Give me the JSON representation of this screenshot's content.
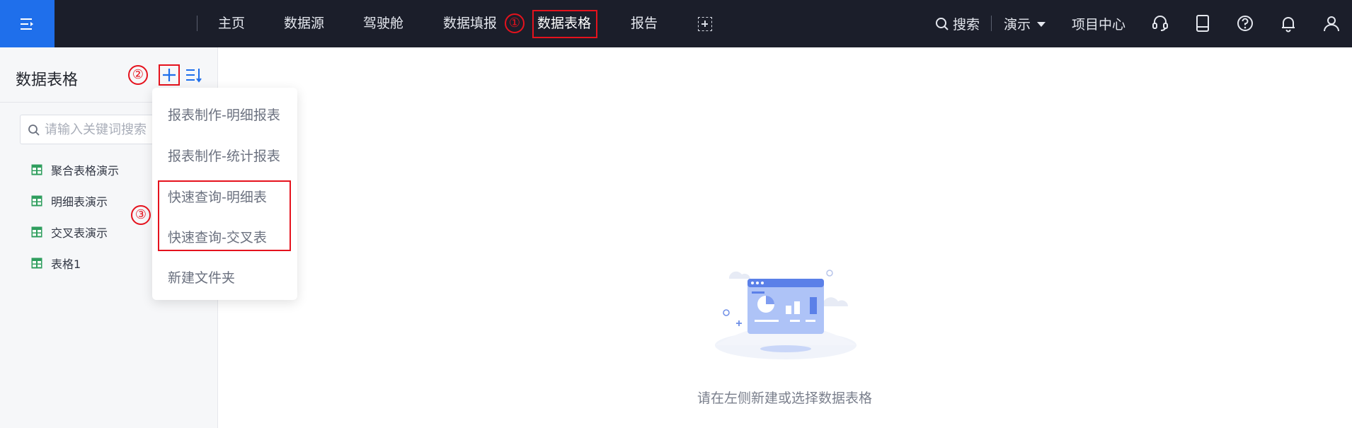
{
  "nav": {
    "items": [
      "主页",
      "数据源",
      "驾驶舱",
      "数据填报",
      "数据表格",
      "报告"
    ],
    "search_label": "搜索",
    "workspace_label": "演示",
    "project_center": "项目中心"
  },
  "annotations": [
    "①",
    "②",
    "③"
  ],
  "sidebar": {
    "title": "数据表格",
    "search_placeholder": "请输入关键词搜索",
    "items": [
      "聚合表格演示",
      "明细表演示",
      "交叉表演示",
      "表格1"
    ]
  },
  "dropdown": {
    "items": [
      "报表制作-明细报表",
      "报表制作-统计报表",
      "快速查询-明细表",
      "快速查询-交叉表",
      "新建文件夹"
    ]
  },
  "main": {
    "empty_message": "请在左侧新建或选择数据表格"
  },
  "colors": {
    "topbar": "#1b1e2a",
    "brand": "#1f6feb",
    "annotation": "#e5121d",
    "table_icon": "#2f9e5e"
  }
}
